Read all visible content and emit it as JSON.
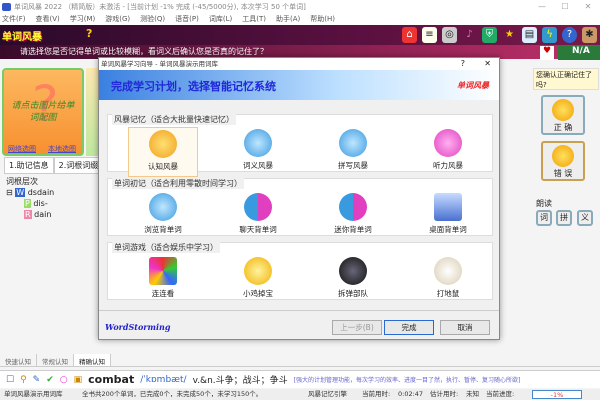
{
  "window": {
    "title": "单词风暴 2022 （精简版）未激活 - [当前计划 -1% 完成 (-45/5000分), 本次学习 50 个单词]",
    "min": "—",
    "max": "☐",
    "close": "✕"
  },
  "menu": [
    "文件(F)",
    "查看(V)",
    "学习(M)",
    "游戏(G)",
    "测验(Q)",
    "语音(P)",
    "词库(L)",
    "工具(T)",
    "助手(A)",
    "帮助(H)"
  ],
  "banner": {
    "brand": "单词风暴",
    "help": "?",
    "nl": "N/A"
  },
  "toolbar_icons": [
    "home-icon",
    "list-icon",
    "speaker-icon",
    "music-icon",
    "shield-icon",
    "runner-icon",
    "book-icon",
    "globe-icon",
    "help-icon",
    "palette-icon"
  ],
  "prompt": "请选择您是否记得单词或比较模糊，看词义后确认您是否真的记住了？",
  "picture": {
    "text": "请点击图片给单词配图",
    "link1": "网络选图",
    "link2": "本地选图"
  },
  "left_tabs": [
    "1.助记信息",
    "2.词根词缀"
  ],
  "tree": {
    "label": "词根层次",
    "root": "dsdain",
    "children": [
      {
        "badge": "P",
        "text": "dis-"
      },
      {
        "badge": "R",
        "text": "dain"
      }
    ]
  },
  "dialog": {
    "title": "单词风暴学习向导 - 单词风暴演示用词库",
    "help": "?",
    "close": "✕",
    "heading": "完成学习计划，选择智能记忆系统",
    "brand": "单词风暴",
    "groups": [
      {
        "label": "风暴记忆（适合大批量快速记忆）",
        "items": [
          "认知风暴",
          "词义风暴",
          "拼写风暴",
          "听力风暴"
        ]
      },
      {
        "label": "单词初记（适合利用零散时间学习）",
        "items": [
          "浏览背单词",
          "聊天背单词",
          "迷你背单词",
          "桌面背单词"
        ]
      },
      {
        "label": "单词游戏（适合娱乐中学习）",
        "items": [
          "连连看",
          "小鸡掉宝",
          "拆弹部队",
          "打地鼠"
        ]
      }
    ],
    "footer_brand": "WordStorming",
    "prev": "上一步(B)",
    "finish": "完成",
    "cancel": "取消"
  },
  "right": {
    "question": "您确认正确记住了吗?",
    "correct": "正 确",
    "wrong": "错 误",
    "read_label": "朗读",
    "read_btns": [
      "词",
      "拼",
      "义"
    ]
  },
  "bottom_tabs": [
    "快速认知",
    "常规认知",
    "精确认知"
  ],
  "word": {
    "word": "combat",
    "phonetic": "/ˈkɒmbæt/",
    "meaning": "v.&n.斗争；战斗；争斗",
    "tip": "[强大的计划管理功能，每次学习的效率、进度一目了然，执行、暂停、复习随心所欲]"
  },
  "status": {
    "lib": "单词风暴演示用词库",
    "summary": "全书共200个单词，已完成0个，未完成50个，未学习150个。",
    "engine": "风暴记忆引擎",
    "time_label": "当前用时:",
    "time": "0:02:47",
    "est_label": "估计用时:",
    "est": "未知",
    "progress_label": "当前进度:",
    "progress": "-1%"
  }
}
